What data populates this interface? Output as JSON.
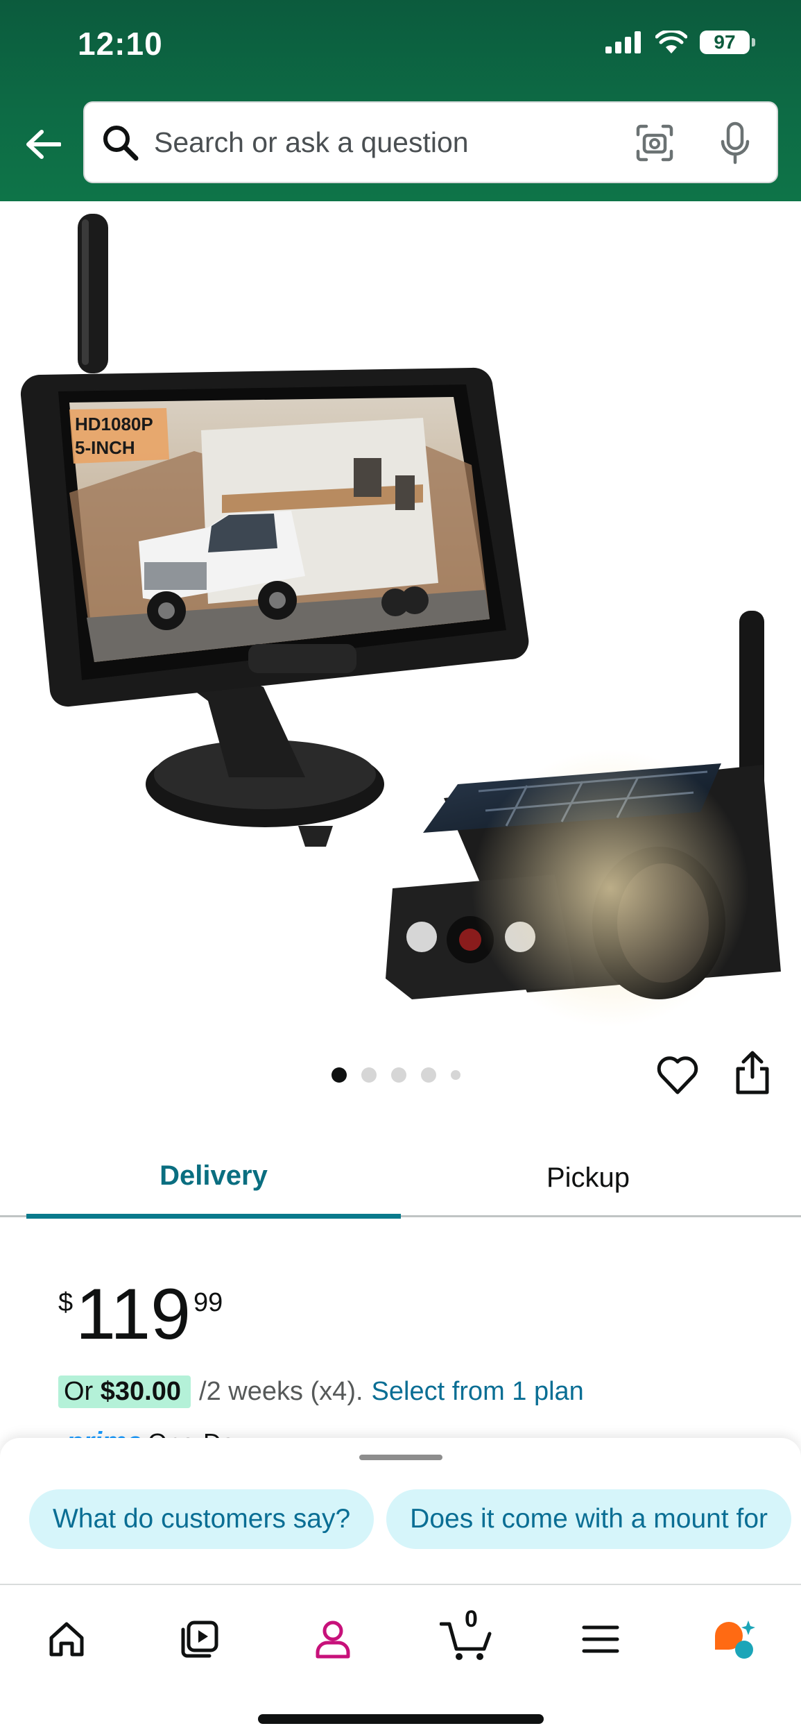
{
  "status_bar": {
    "time": "12:10",
    "battery": "97"
  },
  "search": {
    "placeholder": "Search or ask a question"
  },
  "product_image": {
    "overlay_text_line1": "HD1080P",
    "overlay_text_line2": "5-INCH"
  },
  "tabs": [
    {
      "label": "Delivery",
      "selected": true
    },
    {
      "label": "Pickup",
      "selected": false
    }
  ],
  "price": {
    "symbol": "$",
    "whole": "119",
    "fraction": "99"
  },
  "installment": {
    "prefix": "Or",
    "amount": "$30.00",
    "schedule": "/2 weeks (x4).",
    "link": "Select from 1 plan"
  },
  "prime": {
    "logo": "prime",
    "text": "One-Day"
  },
  "chips": [
    "What do customers say?",
    "Does it come with a mount for"
  ],
  "cart": {
    "count": "0"
  },
  "colors": {
    "header_green": "#0c5b3d",
    "accent_teal": "#0a7a8c",
    "link_blue": "#0a6e94",
    "chip_background": "#d6f5fa",
    "installment_highlight": "#b4f1d8",
    "profile_magenta": "#c7117a"
  },
  "icons": [
    "back-arrow",
    "search",
    "camera-lens",
    "microphone",
    "heart",
    "share",
    "home",
    "video",
    "profile",
    "cart",
    "menu",
    "rufus-ai"
  ]
}
